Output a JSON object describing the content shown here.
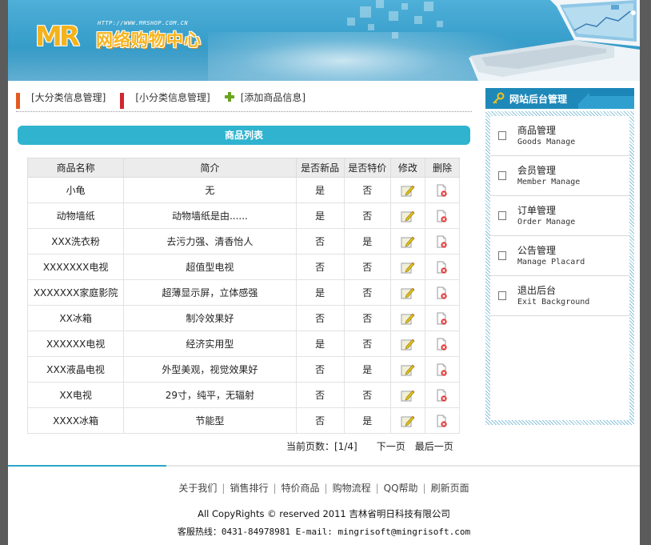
{
  "banner": {
    "url_text": "HTTP://WWW.MRSHOP.COM.CN",
    "logo_mr": "MR",
    "logo_title": "网络购物中心"
  },
  "topnav": {
    "items": [
      {
        "label": "[大分类信息管理]"
      },
      {
        "label": "[小分类信息管理]"
      },
      {
        "label": "[添加商品信息]"
      }
    ]
  },
  "list_title": "商品列表",
  "table": {
    "headers": [
      "商品名称",
      "简介",
      "是否新品",
      "是否特价",
      "修改",
      "删除"
    ],
    "rows": [
      {
        "name": "小龟",
        "desc": "无",
        "is_new": "是",
        "is_special": "否"
      },
      {
        "name": "动物墙纸",
        "desc": "动物墙纸是由......",
        "is_new": "是",
        "is_special": "否"
      },
      {
        "name": "XXX洗衣粉",
        "desc": "去污力强、清香怡人",
        "is_new": "否",
        "is_special": "是"
      },
      {
        "name": "XXXXXXX电视",
        "desc": "超值型电视",
        "is_new": "否",
        "is_special": "否"
      },
      {
        "name": "XXXXXXX家庭影院",
        "desc": "超薄显示屏，立体感强",
        "is_new": "是",
        "is_special": "否"
      },
      {
        "name": "XX冰箱",
        "desc": "制冷效果好",
        "is_new": "否",
        "is_special": "否"
      },
      {
        "name": "XXXXXX电视",
        "desc": "经济实用型",
        "is_new": "是",
        "is_special": "否"
      },
      {
        "name": "XXX液晶电视",
        "desc": "外型美观，视觉效果好",
        "is_new": "否",
        "is_special": "是"
      },
      {
        "name": "XX电视",
        "desc": "29寸，纯平，无辐射",
        "is_new": "否",
        "is_special": "否"
      },
      {
        "name": "XXXX冰箱",
        "desc": "节能型",
        "is_new": "否",
        "is_special": "是"
      }
    ]
  },
  "pager": {
    "current": "当前页数：[1/4]",
    "next": "下一页",
    "last": "最后一页"
  },
  "sidebar": {
    "title": "网站后台管理",
    "items": [
      {
        "cn": "商品管理",
        "en": "Goods Manage"
      },
      {
        "cn": "会员管理",
        "en": "Member Manage"
      },
      {
        "cn": "订单管理",
        "en": "Order Manage"
      },
      {
        "cn": "公告管理",
        "en": "Manage Placard"
      },
      {
        "cn": "退出后台",
        "en": "Exit Background"
      }
    ]
  },
  "footer": {
    "links": [
      "关于我们",
      "销售排行",
      "特价商品",
      "购物流程",
      "QQ帮助",
      "刷新页面"
    ],
    "copyright": "All CopyRights © reserved 2011 吉林省明日科技有限公司",
    "hotline_label": "客服热线：",
    "hotline_value": "0431-84978981 E-mail: mingrisoft@mingrisoft.com"
  },
  "colors": {
    "accent": "#2fb3cf",
    "sidebar_blue": "#1e88b9",
    "page_bg": "#5b5b5b"
  }
}
